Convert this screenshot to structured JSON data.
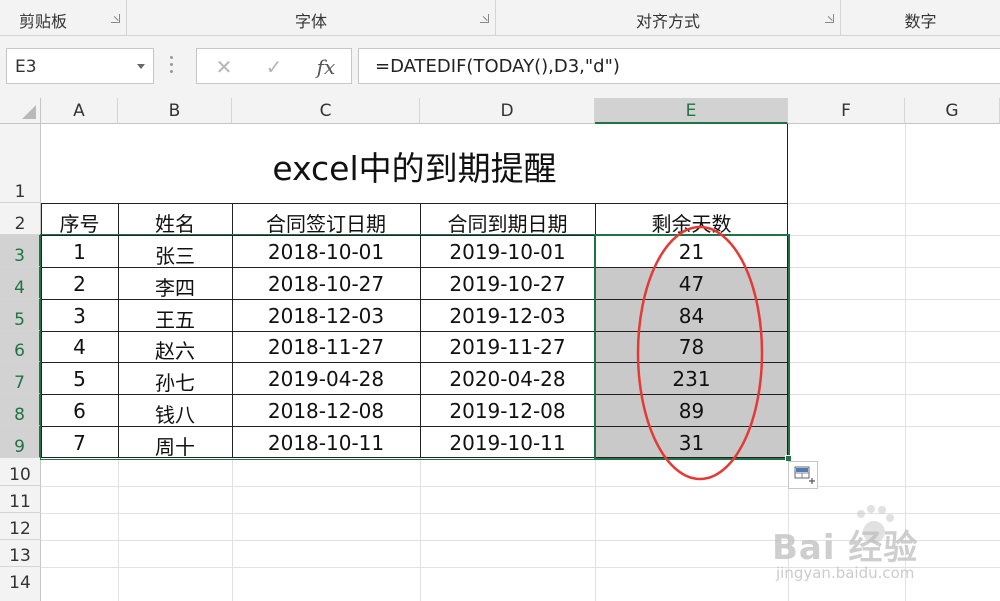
{
  "ribbon": {
    "groups": [
      {
        "label": "剪贴板"
      },
      {
        "label": "字体"
      },
      {
        "label": "对齐方式"
      },
      {
        "label": "数字"
      }
    ]
  },
  "formula_bar": {
    "name_box": "E3",
    "cancel_icon": "✕",
    "enter_icon": "✓",
    "fx_label": "fx",
    "formula": "=DATEDIF(TODAY(),D3,\"d\")"
  },
  "columns": [
    "A",
    "B",
    "C",
    "D",
    "E",
    "F",
    "G"
  ],
  "selected_column": "E",
  "rows": [
    "1",
    "2",
    "3",
    "4",
    "5",
    "6",
    "7",
    "8",
    "9",
    "10",
    "11",
    "12",
    "13",
    "14"
  ],
  "selected_rows": [
    "3",
    "4",
    "5",
    "6",
    "7",
    "8",
    "9"
  ],
  "sheet": {
    "title": "excel中的到期提醒",
    "headers": [
      "序号",
      "姓名",
      "合同签订日期",
      "合同到期日期",
      "剩余天数"
    ],
    "records": [
      [
        "1",
        "张三",
        "2018-10-01",
        "2019-10-01",
        "21"
      ],
      [
        "2",
        "李四",
        "2018-10-27",
        "2019-10-27",
        "47"
      ],
      [
        "3",
        "王五",
        "2018-12-03",
        "2019-12-03",
        "84"
      ],
      [
        "4",
        "赵六",
        "2018-11-27",
        "2019-11-27",
        "78"
      ],
      [
        "5",
        "孙七",
        "2019-04-28",
        "2020-04-28",
        "231"
      ],
      [
        "6",
        "钱八",
        "2018-12-08",
        "2019-12-08",
        "89"
      ],
      [
        "7",
        "周十",
        "2018-10-11",
        "2019-10-11",
        "31"
      ]
    ]
  },
  "annotation": {
    "color": "#e53935"
  },
  "watermark": {
    "brand": "Bai  经验",
    "url": "jingyan.baidu.com"
  },
  "colors": {
    "accent": "#217346",
    "shade": "#c9c9c9"
  }
}
